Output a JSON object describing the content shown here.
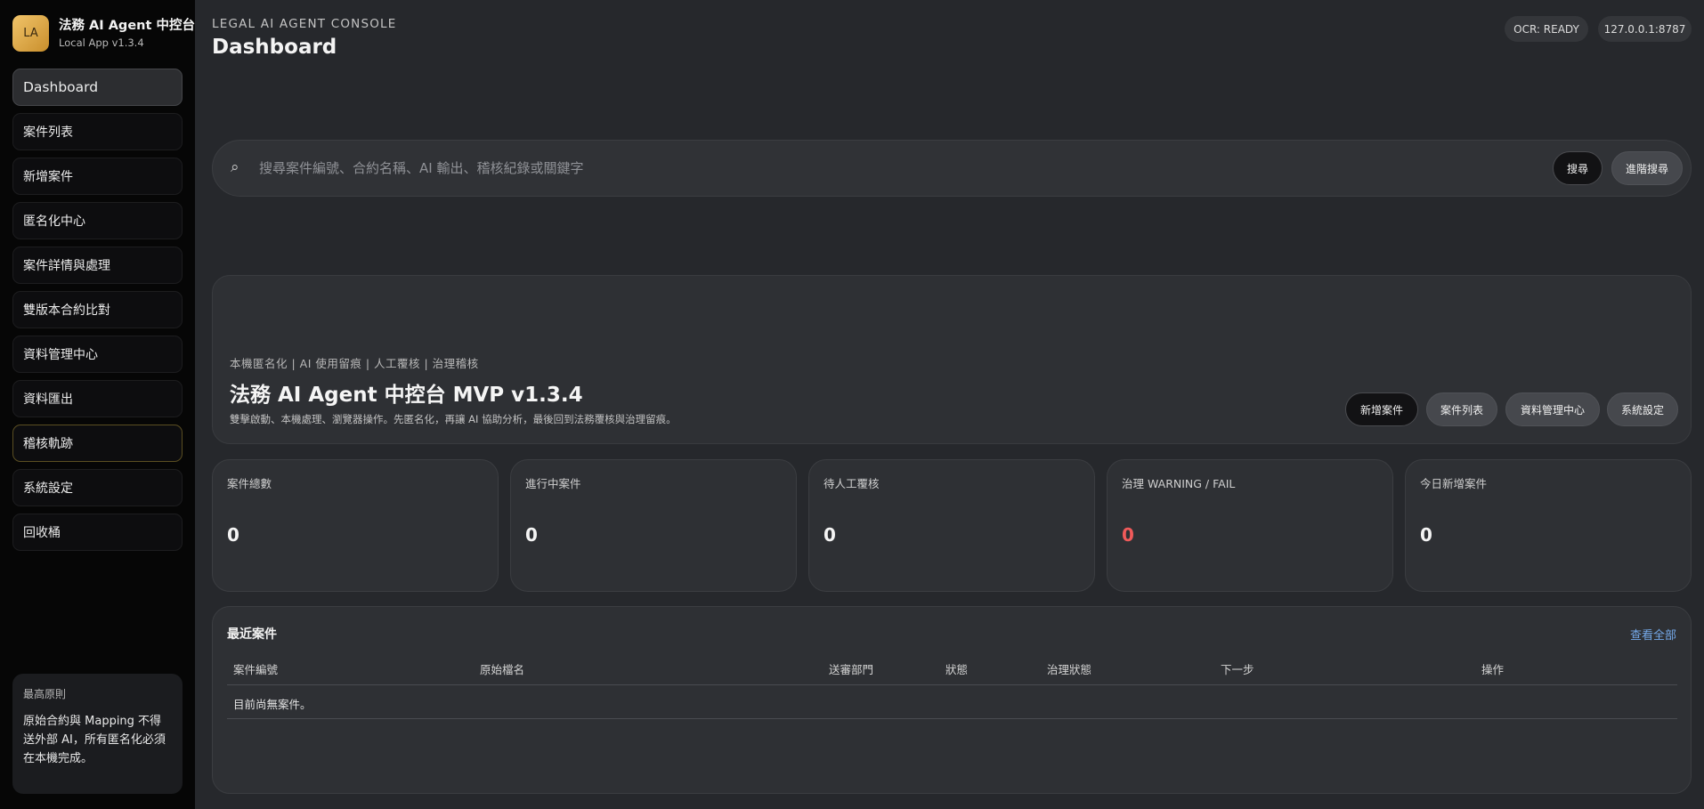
{
  "app": {
    "logo_text": "LA",
    "title": "法務 AI Agent 中控台",
    "version": "Local App v1.3.4"
  },
  "sidebar": {
    "items": [
      {
        "label": "Dashboard"
      },
      {
        "label": "案件列表"
      },
      {
        "label": "新增案件"
      },
      {
        "label": "匿名化中心"
      },
      {
        "label": "案件詳情與處理"
      },
      {
        "label": "雙版本合約比對"
      },
      {
        "label": "資料管理中心"
      },
      {
        "label": "資料匯出"
      },
      {
        "label": "稽核軌跡"
      },
      {
        "label": "系統設定"
      },
      {
        "label": "回收桶"
      }
    ],
    "principle": {
      "title": "最高原則",
      "body": "原始合約與 Mapping 不得送外部 AI，所有匿名化必須在本機完成。"
    }
  },
  "header": {
    "eyebrow": "LEGAL AI AGENT CONSOLE",
    "title": "Dashboard",
    "ocr_status": "OCR: READY",
    "address": "127.0.0.1:8787"
  },
  "search": {
    "placeholder": "搜尋案件編號、合約名稱、AI 輸出、稽核紀錄或關鍵字",
    "value": "",
    "search_button": "搜尋",
    "advanced_button": "進階搜尋"
  },
  "hero": {
    "tags": "本機匿名化 | AI 使用留痕 | 人工覆核 | 治理稽核",
    "title": "法務 AI Agent 中控台 MVP v1.3.4",
    "description": "雙擊啟動、本機處理、瀏覽器操作。先匿名化，再讓 AI 協助分析，最後回到法務覆核與治理留痕。",
    "buttons": [
      "新增案件",
      "案件列表",
      "資料管理中心",
      "系統設定"
    ]
  },
  "stats": [
    {
      "label": "案件總數",
      "value": "0",
      "color": "#f4f4f4"
    },
    {
      "label": "進行中案件",
      "value": "0",
      "color": "#f4f4f4"
    },
    {
      "label": "待人工覆核",
      "value": "0",
      "color": "#f4f4f4"
    },
    {
      "label": "治理 WARNING / FAIL",
      "value": "0",
      "color": "#f05a5a"
    },
    {
      "label": "今日新增案件",
      "value": "0",
      "color": "#f4f4f4"
    }
  ],
  "recent": {
    "title": "最近案件",
    "view_all": "查看全部",
    "columns": [
      "案件編號",
      "原始檔名",
      "送審部門",
      "狀態",
      "治理狀態",
      "下一步",
      "操作"
    ],
    "empty_message": "目前尚無案件。"
  },
  "colors": {
    "accent_gold": "#e0a94a",
    "link_blue": "#74a8e8",
    "warning_red": "#f05a5a"
  }
}
